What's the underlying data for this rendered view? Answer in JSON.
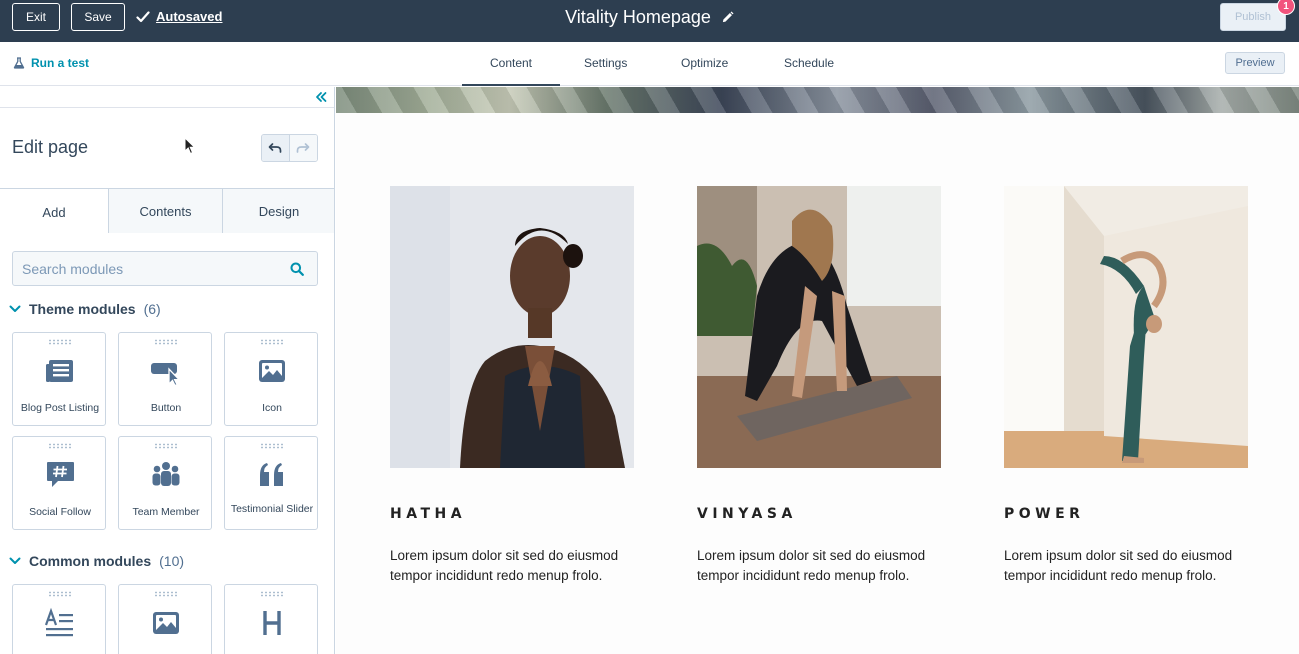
{
  "topbar": {
    "exit_label": "Exit",
    "save_label": "Save",
    "autosaved_label": "Autosaved",
    "page_title": "Vitality Homepage",
    "publish_label": "Publish",
    "notification_count": "1"
  },
  "subbar": {
    "run_test_label": "Run a test",
    "tabs": [
      "Content",
      "Settings",
      "Optimize",
      "Schedule"
    ],
    "active_tab": "Content",
    "preview_label": "Preview"
  },
  "sidebar": {
    "title": "Edit page",
    "tabs": [
      "Add",
      "Contents",
      "Design"
    ],
    "active_tab": "Add",
    "search_placeholder": "Search modules",
    "sections": [
      {
        "name": "Theme modules",
        "count": "(6)",
        "modules": [
          {
            "label": "Blog Post Listing",
            "icon": "blog-listing-icon"
          },
          {
            "label": "Button",
            "icon": "button-cursor-icon"
          },
          {
            "label": "Icon",
            "icon": "image-icon"
          },
          {
            "label": "Social Follow",
            "icon": "hashtag-chat-icon"
          },
          {
            "label": "Team Member",
            "icon": "people-icon"
          },
          {
            "label": "Testimonial Slider",
            "icon": "quote-icon"
          }
        ]
      },
      {
        "name": "Common modules",
        "count": "(10)",
        "modules": [
          {
            "label": "",
            "icon": "text-icon"
          },
          {
            "label": "",
            "icon": "image-icon"
          },
          {
            "label": "",
            "icon": "heading-icon"
          }
        ]
      }
    ]
  },
  "canvas": {
    "cards": [
      {
        "heading": "HATHA",
        "desc": "Lorem ipsum dolor sit sed do eiusmod tempor incididunt redo menup frolo."
      },
      {
        "heading": "VINYASA",
        "desc": "Lorem ipsum dolor sit sed do eiusmod tempor incididunt redo menup frolo."
      },
      {
        "heading": "POWER",
        "desc": "Lorem ipsum dolor sit sed do eiusmod tempor incididunt redo menup frolo."
      }
    ]
  },
  "colors": {
    "topbar_bg": "#2d3e50",
    "accent": "#0091ae",
    "badge": "#f2547d",
    "icon": "#516f90"
  }
}
